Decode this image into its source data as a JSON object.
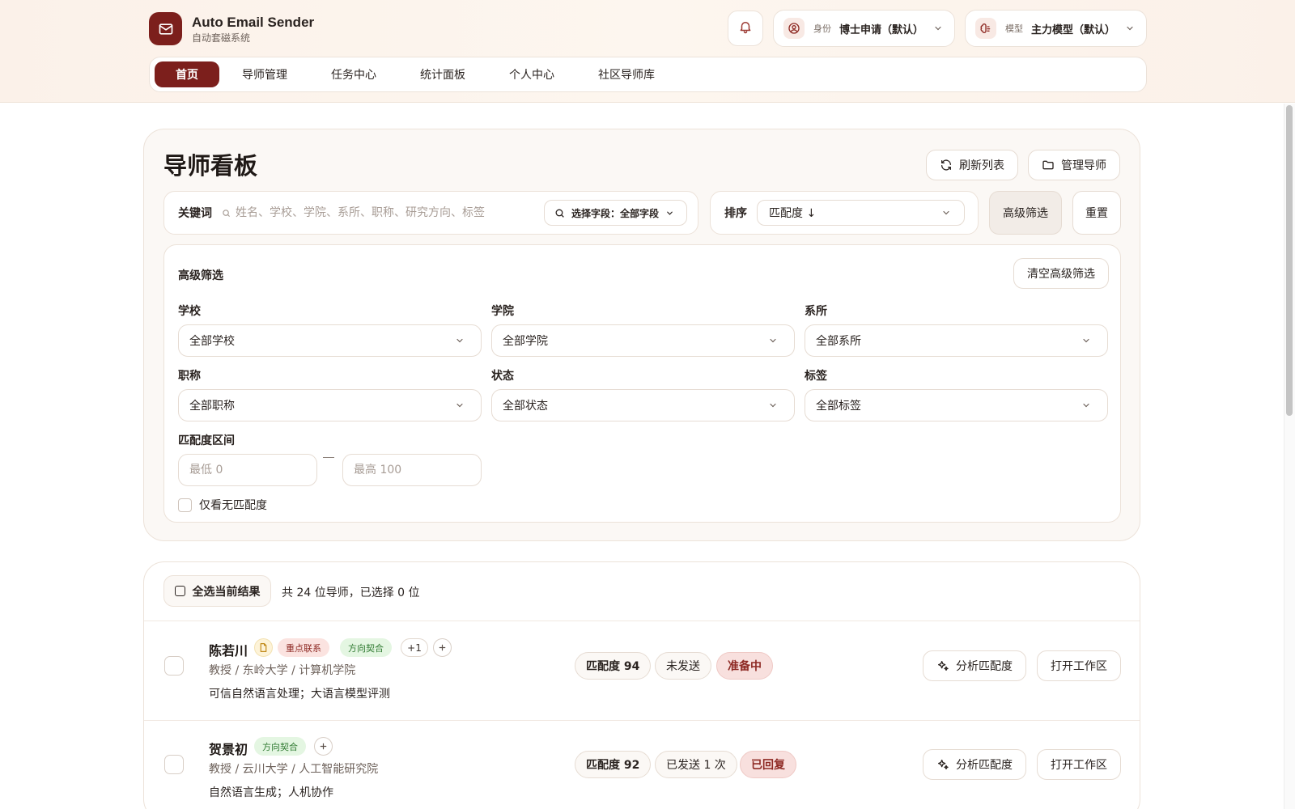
{
  "brand": {
    "title": "Auto Email Sender",
    "subtitle": "自动套磁系统",
    "logo_icon": "mail-icon",
    "accent": "#7c1f1c"
  },
  "header": {
    "identity": {
      "label": "身份",
      "value": "博士申请（默认）",
      "icon": "user-circle-icon"
    },
    "model": {
      "label": "模型",
      "value": "主力模型（默认）",
      "icon": "brain-icon"
    },
    "bell_icon": "bell-icon"
  },
  "nav": {
    "items": [
      {
        "label": "首页",
        "active": true
      },
      {
        "label": "导师管理"
      },
      {
        "label": "任务中心"
      },
      {
        "label": "统计面板"
      },
      {
        "label": "个人中心"
      },
      {
        "label": "社区导师库"
      }
    ]
  },
  "board": {
    "title": "导师看板",
    "refresh_label": "刷新列表",
    "manage_label": "管理导师",
    "search": {
      "label": "关键词",
      "placeholder": "姓名、学校、学院、系所、职称、研究方向、标签",
      "field_select": "选择字段：全部字段"
    },
    "sort": {
      "label": "排序",
      "value": "匹配度 ↓"
    },
    "advanced_button": "高级筛选",
    "reset_button": "重置"
  },
  "advanced": {
    "title": "高级筛选",
    "clear_label": "清空高级筛选",
    "filters": [
      {
        "label": "学校",
        "value": "全部学校"
      },
      {
        "label": "学院",
        "value": "全部学院"
      },
      {
        "label": "系所",
        "value": "全部系所"
      },
      {
        "label": "职称",
        "value": "全部职称"
      },
      {
        "label": "状态",
        "value": "全部状态"
      },
      {
        "label": "标签",
        "value": "全部标签"
      }
    ],
    "range": {
      "label": "匹配度区间",
      "min_placeholder": "最低 0",
      "max_placeholder": "最高 100"
    },
    "no_score_label": "仅看无匹配度"
  },
  "list": {
    "select_all_label": "全选当前结果",
    "count_text": "共 24 位导师，已选择 0 位",
    "rows": [
      {
        "name": "陈若川",
        "tags": [
          "重点联系",
          "方向契合"
        ],
        "more": "+1",
        "meta": "教授 / 东岭大学 / 计算机学院",
        "desc": "可信自然语言处理；大语言模型评测",
        "score": "匹配度 94",
        "sent": "未发送",
        "status": "准备中",
        "analyze_label": "分析匹配度",
        "open_label": "打开工作区"
      },
      {
        "name": "贺景初",
        "tags": [
          "方向契合"
        ],
        "meta": "教授 / 云川大学 / 人工智能研究院",
        "desc": "自然语言生成；人机协作",
        "score": "匹配度 92",
        "sent": "已发送 1 次",
        "status": "已回复",
        "analyze_label": "分析匹配度",
        "open_label": "打开工作区"
      }
    ]
  }
}
